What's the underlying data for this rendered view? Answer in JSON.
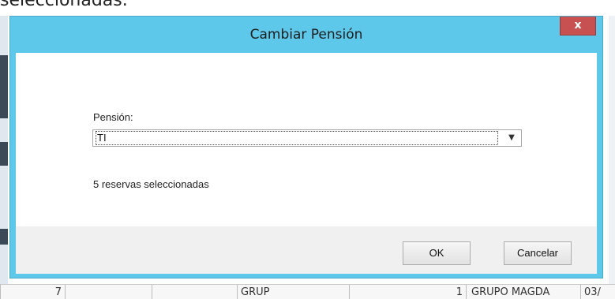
{
  "background": {
    "caption": "seleccionadas.",
    "grid_row": [
      "7",
      "",
      "",
      "GRUP",
      "1",
      "GRUPO MAGDA",
      "03/"
    ]
  },
  "dialog": {
    "title": "Cambiar Pensión",
    "close_label": "x",
    "pension_label": "Pensión:",
    "pension_value": "TI",
    "dropdown_arrow": "▼",
    "info_text": "5 reservas seleccionadas",
    "ok_label": "OK",
    "cancel_label": "Cancelar"
  },
  "colors": {
    "title_bar": "#5ec8ea",
    "close_button": "#c75050",
    "footer": "#f0f0f0"
  }
}
